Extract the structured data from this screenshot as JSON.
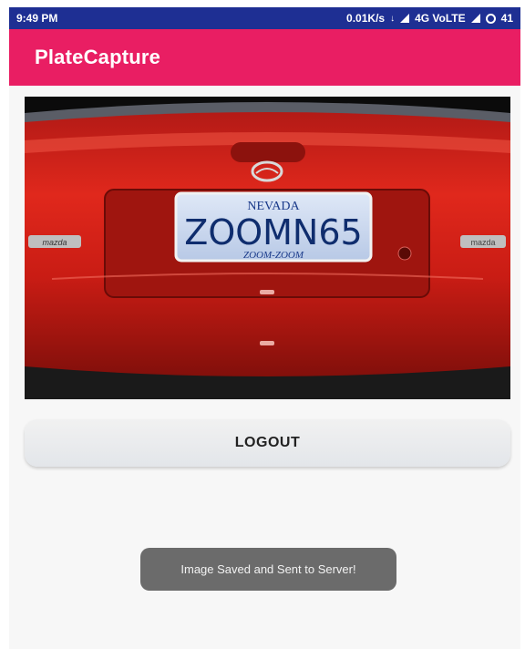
{
  "status_bar": {
    "time": "9:49 PM",
    "network": "0.01K/s",
    "carrier": "4G VoLTE",
    "battery": "41"
  },
  "app_bar": {
    "title": "PlateCapture"
  },
  "photo": {
    "plate_state": "NEVADA",
    "plate_number": "ZOOMN65",
    "plate_slogan": "ZOOM-ZOOM",
    "side_badge": "mazda"
  },
  "buttons": {
    "logout_label": "LOGOUT"
  },
  "toast": {
    "message": "Image Saved and Sent to Server!"
  },
  "colors": {
    "status_bar": "#1e2f93",
    "app_bar": "#e91e63",
    "toast": "#6b6b6b"
  }
}
